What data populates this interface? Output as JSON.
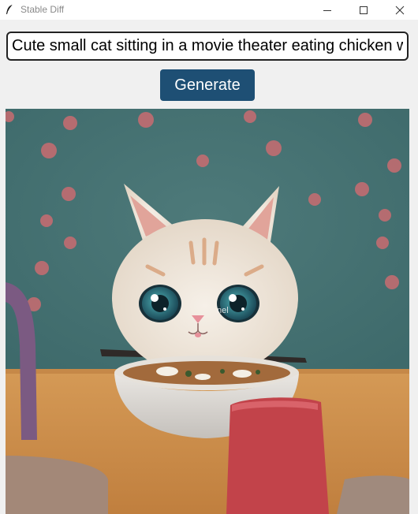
{
  "window": {
    "title": "Stable Diff",
    "icon": "feather-icon",
    "controls": [
      "minimize-icon",
      "maximize-icon",
      "close-icon"
    ]
  },
  "prompt": {
    "value": "Cute small cat sitting in a movie theater eating chicken wi"
  },
  "generate_button": {
    "label": "Generate",
    "color": "#1e4f74"
  },
  "image": {
    "subject": "generated-image-cat",
    "watermark": "nel"
  }
}
